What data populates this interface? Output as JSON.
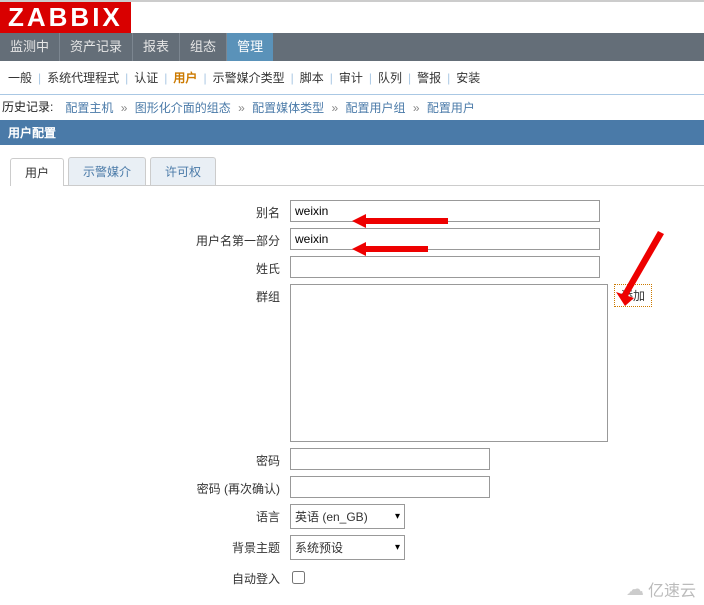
{
  "logo": "ZABBIX",
  "main_menu": [
    "监测中",
    "资产记录",
    "报表",
    "组态",
    "管理"
  ],
  "main_menu_active": 4,
  "sub_menu": [
    "一般",
    "系统代理程式",
    "认证",
    "用户",
    "示警媒介类型",
    "脚本",
    "审计",
    "队列",
    "警报",
    "安装"
  ],
  "sub_menu_active": 3,
  "history_label": "历史记录:",
  "breadcrumbs": [
    "配置主机",
    "图形化介面的组态",
    "配置媒体类型",
    "配置用户组",
    "配置用户"
  ],
  "section_title": "用户配置",
  "tabs": [
    "用户",
    "示警媒介",
    "许可权"
  ],
  "tabs_active": 0,
  "form": {
    "alias_label": "别名",
    "alias_value": "weixin",
    "name_label": "用户名第一部分",
    "name_value": "weixin",
    "surname_label": "姓氏",
    "surname_value": "",
    "groups_label": "群组",
    "add_button": "添加",
    "password_label": "密码",
    "password_value": "",
    "password2_label": "密码 (再次确认)",
    "password2_value": "",
    "lang_label": "语言",
    "lang_value": "英语 (en_GB)",
    "theme_label": "背景主题",
    "theme_value": "系统预设",
    "autologin_label": "自动登入"
  },
  "watermark": "亿速云"
}
